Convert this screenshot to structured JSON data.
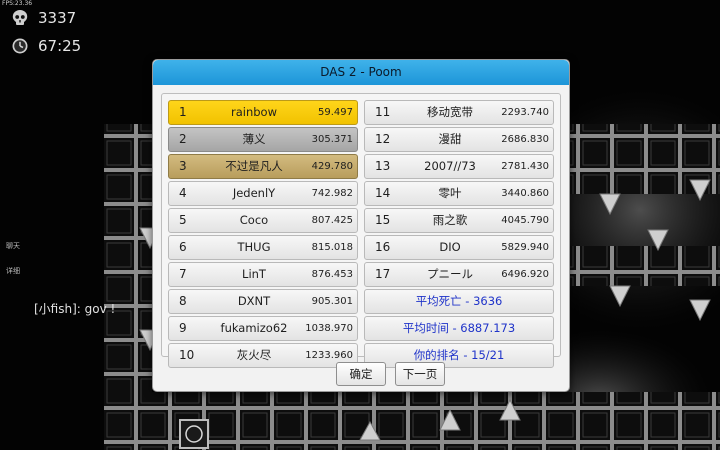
{
  "hud": {
    "fps": "FPS:23.36",
    "deaths": "3337",
    "timer": "67:25",
    "deaths_icon": "skull-icon",
    "timer_icon": "clock-icon"
  },
  "side_tags": {
    "chat": "聊天",
    "detail": "详细"
  },
  "chat_line": "[小fish]: gov !",
  "dialog": {
    "title": "DAS 2 - Poom",
    "left_column": [
      {
        "rank": "1",
        "name": "rainbow",
        "time": "59.497",
        "style": "gold"
      },
      {
        "rank": "2",
        "name": "薄义",
        "time": "305.371",
        "style": "silver"
      },
      {
        "rank": "3",
        "name": "不过是凡人",
        "time": "429.780",
        "style": "bronze"
      },
      {
        "rank": "4",
        "name": "JedenlY",
        "time": "742.982",
        "style": "normal"
      },
      {
        "rank": "5",
        "name": "Coco",
        "time": "807.425",
        "style": "normal"
      },
      {
        "rank": "6",
        "name": "THUG",
        "time": "815.018",
        "style": "normal"
      },
      {
        "rank": "7",
        "name": "LinT",
        "time": "876.453",
        "style": "normal"
      },
      {
        "rank": "8",
        "name": "DXNT",
        "time": "905.301",
        "style": "normal"
      },
      {
        "rank": "9",
        "name": "fukamizo62",
        "time": "1038.970",
        "style": "normal"
      },
      {
        "rank": "10",
        "name": "灰火尽",
        "time": "1233.960",
        "style": "normal"
      }
    ],
    "right_column": [
      {
        "rank": "11",
        "name": "移动宽带",
        "time": "2293.740"
      },
      {
        "rank": "12",
        "name": "漫甜",
        "time": "2686.830"
      },
      {
        "rank": "13",
        "name": "2007//73",
        "time": "2781.430"
      },
      {
        "rank": "14",
        "name": "零叶",
        "time": "3440.860"
      },
      {
        "rank": "15",
        "name": "雨之歌",
        "time": "4045.790"
      },
      {
        "rank": "16",
        "name": "DIO",
        "time": "5829.940"
      },
      {
        "rank": "17",
        "name": "プニール",
        "time": "6496.920"
      }
    ],
    "stats": {
      "avg_deaths": "平均死亡 - 3636",
      "avg_time": "平均时间 - 6887.173",
      "your_rank": "你的排名 - 15/21"
    },
    "buttons": {
      "ok": "确定",
      "next": "下一页"
    }
  },
  "colors": {
    "header": "#2aa3e0",
    "gold": "#f5c800",
    "silver": "#b0b0b0",
    "bronze": "#c2a76a",
    "stat_text": "#1f33c9"
  }
}
